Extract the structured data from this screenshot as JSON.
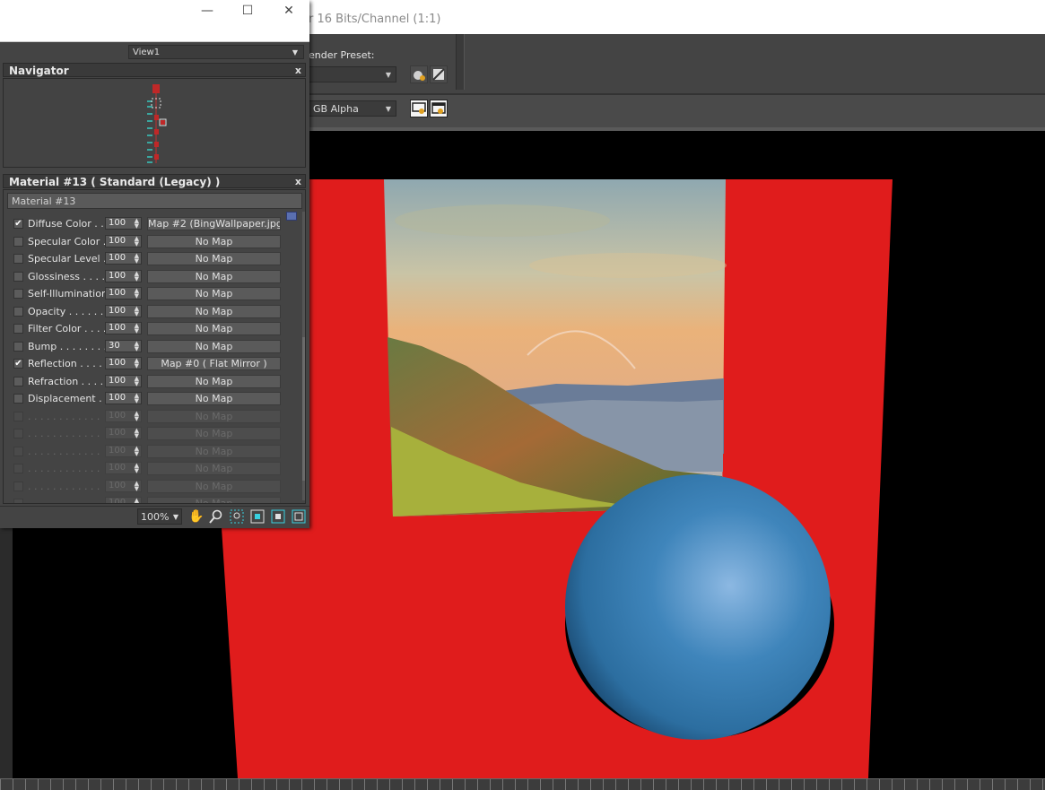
{
  "render_window": {
    "title": "r 16 Bits/Channel (1:1)",
    "render_preset_label": "ender Preset:",
    "preset_value": "",
    "channel_value": "GB Alpha",
    "icons": [
      "teapot-settings-icon",
      "environment-icon",
      "display-icon",
      "render-frame-icon"
    ]
  },
  "material_editor": {
    "window_buttons": {
      "minimize": "—",
      "maximize": "☐",
      "close": "✕"
    },
    "view_dropdown": "View1",
    "navigator": {
      "title": "Navigator",
      "close": "x"
    },
    "material_panel": {
      "title": "Material #13  ( Standard (Legacy) )",
      "close": "x",
      "material_name": "Material #13",
      "maps": [
        {
          "label": "Diffuse Color . . .",
          "checked": true,
          "amount": "100",
          "map": "Map #2 (BingWallpaper.jpg)"
        },
        {
          "label": "Specular Color  .",
          "checked": false,
          "amount": "100",
          "map": "No Map"
        },
        {
          "label": "Specular Level  .",
          "checked": false,
          "amount": "100",
          "map": "No Map"
        },
        {
          "label": "Glossiness  . . . .",
          "checked": false,
          "amount": "100",
          "map": "No Map"
        },
        {
          "label": "Self-Illumination .",
          "checked": false,
          "amount": "100",
          "map": "No Map"
        },
        {
          "label": "Opacity . . . . . .",
          "checked": false,
          "amount": "100",
          "map": "No Map"
        },
        {
          "label": "Filter Color  . . . .",
          "checked": false,
          "amount": "100",
          "map": "No Map"
        },
        {
          "label": "Bump  . . . . . . . .",
          "checked": false,
          "amount": "30",
          "map": "No Map"
        },
        {
          "label": "Reflection  . . . .",
          "checked": true,
          "amount": "100",
          "map": "Map #0  ( Flat Mirror )"
        },
        {
          "label": "Refraction  . . . .",
          "checked": false,
          "amount": "100",
          "map": "No Map"
        },
        {
          "label": "Displacement  . .",
          "checked": false,
          "amount": "100",
          "map": "No Map"
        },
        {
          "label": ". . . . . . . . . . . .",
          "checked": false,
          "amount": "100",
          "map": "No Map",
          "disabled": true
        },
        {
          "label": ". . . . . . . . . . . .",
          "checked": false,
          "amount": "100",
          "map": "No Map",
          "disabled": true
        },
        {
          "label": ". . . . . . . . . . . .",
          "checked": false,
          "amount": "100",
          "map": "No Map",
          "disabled": true
        },
        {
          "label": ". . . . . . . . . . . .",
          "checked": false,
          "amount": "100",
          "map": "No Map",
          "disabled": true
        },
        {
          "label": ". . . . . . . . . . . .",
          "checked": false,
          "amount": "100",
          "map": "No Map",
          "disabled": true
        },
        {
          "label": ". . . . . . . . . . . .",
          "checked": false,
          "amount": "100",
          "map": "No Map",
          "disabled": true
        }
      ]
    },
    "bottom_bar": {
      "zoom": "100%",
      "tools": [
        "pan-hand-icon",
        "zoom-icon",
        "zoom-region-icon",
        "frame-selected-icon",
        "zoom-extents-icon",
        "zoom-extents-all-icon"
      ]
    }
  },
  "colors": {
    "plane_red": "#e01c1c",
    "sphere_blue": "#3a7fb5",
    "panel_bg": "#444444"
  }
}
